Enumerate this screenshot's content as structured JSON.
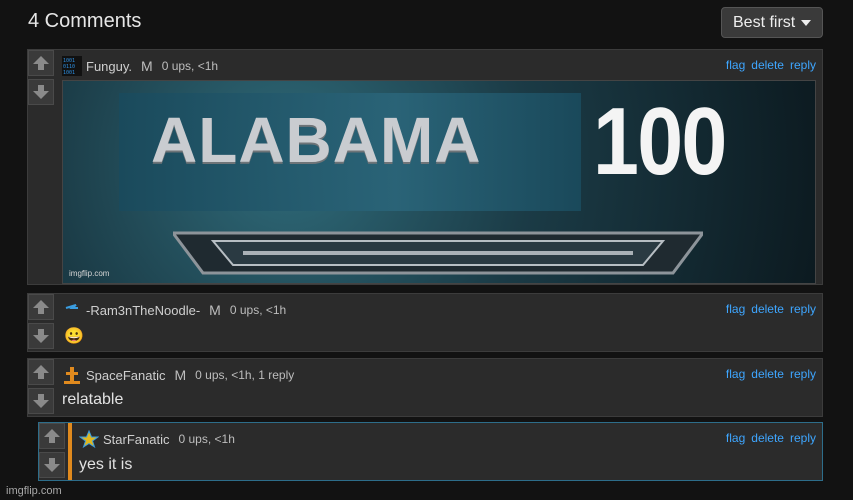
{
  "header": {
    "title": "4 Comments",
    "sort_label": "Best first"
  },
  "comments": [
    {
      "username": "Funguy.",
      "mod": "M",
      "stats": "0 ups, <1h",
      "actions": [
        "flag",
        "delete",
        "reply"
      ],
      "meme": {
        "word": "ALABAMA",
        "number": "100",
        "watermark": "imgflip.com"
      }
    },
    {
      "username": "-Ram3nTheNoodle-",
      "mod": "M",
      "stats": "0 ups, <1h",
      "actions": [
        "flag",
        "delete",
        "reply"
      ],
      "text": "😀"
    },
    {
      "username": "SpaceFanatic",
      "mod": "M",
      "stats": "0 ups, <1h, 1 reply",
      "actions": [
        "flag",
        "delete",
        "reply"
      ],
      "text": "relatable"
    },
    {
      "username": "StarFanatic",
      "stats": "0 ups, <1h",
      "actions": [
        "flag",
        "delete",
        "reply"
      ],
      "text": "yes it is"
    }
  ],
  "footer": {
    "watermark": "imgflip.com"
  },
  "colors": {
    "background": "#121212",
    "link": "#3ea6ff",
    "reply_border": "#2d6d8a",
    "accent_orange": "#e08a1e"
  }
}
